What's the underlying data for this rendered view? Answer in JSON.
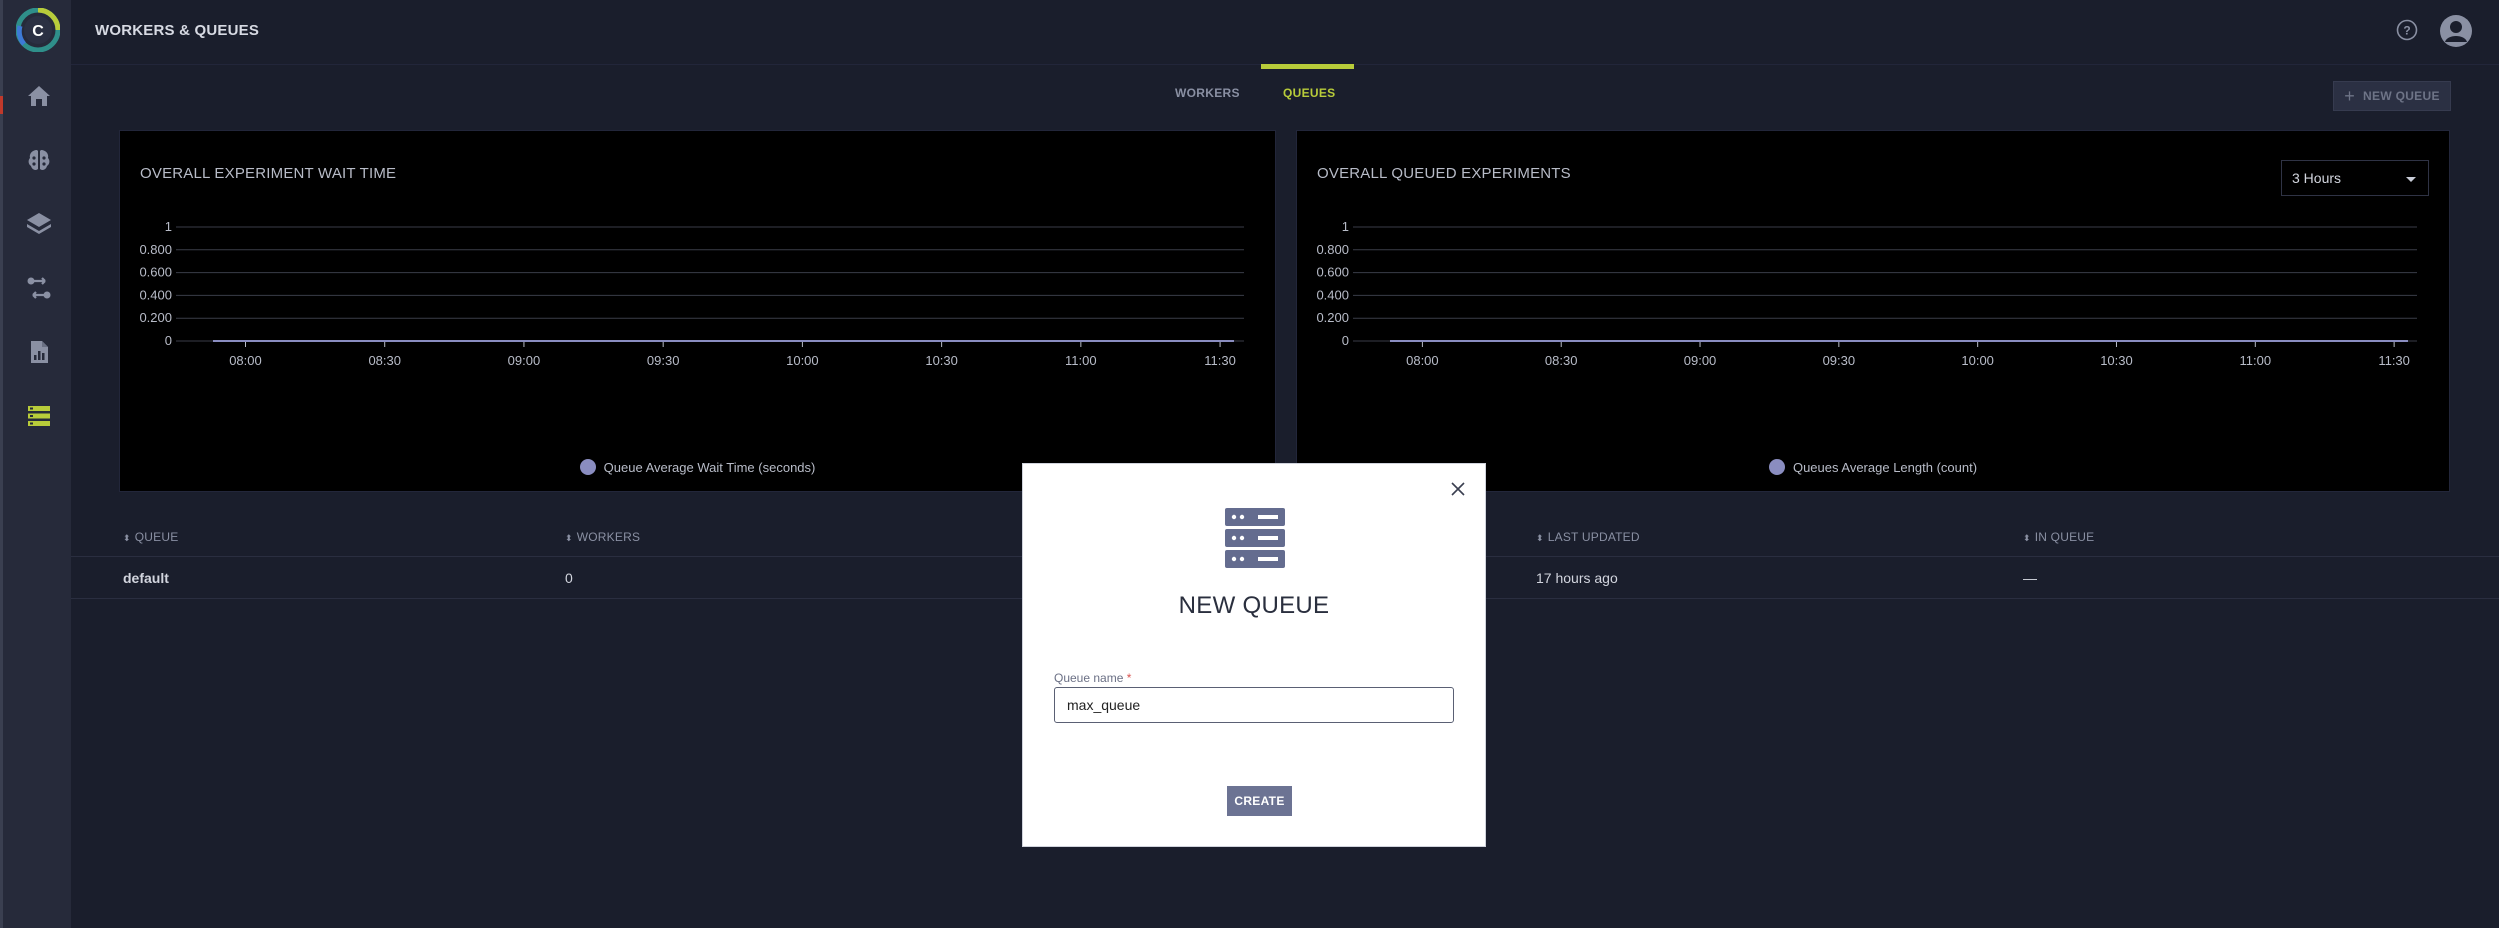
{
  "header": {
    "title": "WORKERS & QUEUES"
  },
  "sidebar": {
    "logo_letter": "C",
    "items": [
      {
        "icon": "home-icon"
      },
      {
        "icon": "brain-icon"
      },
      {
        "icon": "layers-icon"
      },
      {
        "icon": "pipelines-icon"
      },
      {
        "icon": "reports-icon"
      },
      {
        "icon": "workers-queues-icon",
        "active": true
      }
    ]
  },
  "tabs": [
    {
      "label": "WORKERS",
      "active": false
    },
    {
      "label": "QUEUES",
      "active": true
    }
  ],
  "toolbar": {
    "new_queue_label": "NEW QUEUE"
  },
  "colors": {
    "accent": "#b8cc3a",
    "series": "#8a8dc0",
    "bg": "#1a1e2c"
  },
  "chart_data": [
    {
      "type": "line",
      "title": "OVERALL EXPERIMENT WAIT TIME",
      "y_ticks": [
        "1",
        "0.800",
        "0.600",
        "0.400",
        "0.200",
        "0"
      ],
      "x_ticks": [
        "08:00",
        "08:30",
        "09:00",
        "09:30",
        "10:00",
        "10:30",
        "11:00",
        "11:30"
      ],
      "ylim": [
        0,
        1
      ],
      "series": [
        {
          "name": "Queue Average Wait Time (seconds)",
          "x": [
            "07:53",
            "11:33"
          ],
          "values": [
            0,
            0
          ]
        }
      ]
    },
    {
      "type": "line",
      "title": "OVERALL QUEUED EXPERIMENTS",
      "y_ticks": [
        "1",
        "0.800",
        "0.600",
        "0.400",
        "0.200",
        "0"
      ],
      "x_ticks": [
        "08:00",
        "08:30",
        "09:00",
        "09:30",
        "10:00",
        "10:30",
        "11:00",
        "11:30"
      ],
      "ylim": [
        0,
        1
      ],
      "series": [
        {
          "name": "Queues Average Length (count)",
          "x": [
            "07:53",
            "11:33"
          ],
          "values": [
            0,
            0
          ]
        }
      ]
    }
  ],
  "time_range": {
    "selected": "3 Hours"
  },
  "table": {
    "columns": [
      "QUEUE",
      "WORKERS",
      "LAST UPDATED",
      "IN QUEUE"
    ],
    "rows": [
      {
        "queue": "default",
        "workers": "0",
        "last_updated": "17 hours ago",
        "in_queue": "—"
      }
    ]
  },
  "modal": {
    "title": "NEW QUEUE",
    "field_label": "Queue name",
    "required_mark": "*",
    "field_value": "max_queue",
    "create_label": "CREATE"
  }
}
